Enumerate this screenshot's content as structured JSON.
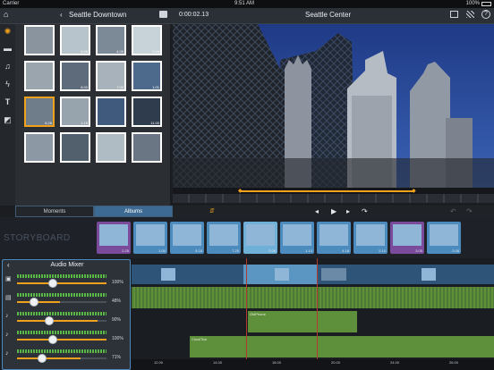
{
  "status": {
    "carrier": "Carrier",
    "time": "9:51 AM",
    "battery": "100%"
  },
  "nav": {
    "back_label": "Seattle Downtown",
    "timecode": "0:00:02.13",
    "project_title": "Seattle Center"
  },
  "media": {
    "durations": [
      "",
      "6.06",
      "4.09",
      "9.00",
      "",
      "8.00",
      "7.00",
      "1.01",
      "6.26",
      "1.15",
      "",
      "11.00",
      "",
      "",
      "",
      ""
    ]
  },
  "tabs": {
    "moments": "Moments",
    "albums": "Albums"
  },
  "storyboard": {
    "label": "STORYBOARD",
    "clip_durations": [
      "2.25",
      "1.00",
      "5.18",
      "7.25",
      "2.06",
      "1.13",
      "4.18",
      "2.10",
      "3.05",
      "2.08"
    ]
  },
  "mixer": {
    "title": "Audio Mixer",
    "rows": [
      {
        "icon": "video-icon",
        "level_pct": "100%",
        "value": 100
      },
      {
        "icon": "film-icon",
        "level_pct": "48%",
        "value": 48
      },
      {
        "icon": "music-note-icon",
        "level_pct": "90%",
        "value": 90
      },
      {
        "icon": "music-note-icon",
        "level_pct": "100%",
        "value": 100
      },
      {
        "icon": "music-note-icon",
        "level_pct": "71%",
        "value": 71
      }
    ]
  },
  "timeline": {
    "audio_labels": {
      "track3": "OldPhone",
      "track4": "ClockTick"
    },
    "ruler_ticks": [
      "12.00",
      "14.00",
      "18.00",
      "20.00",
      "24.00",
      "26.00"
    ]
  },
  "colors": {
    "accent": "#f1a11c",
    "selection_blue": "#4a88c0",
    "audio_green": "#5e8f3b"
  }
}
